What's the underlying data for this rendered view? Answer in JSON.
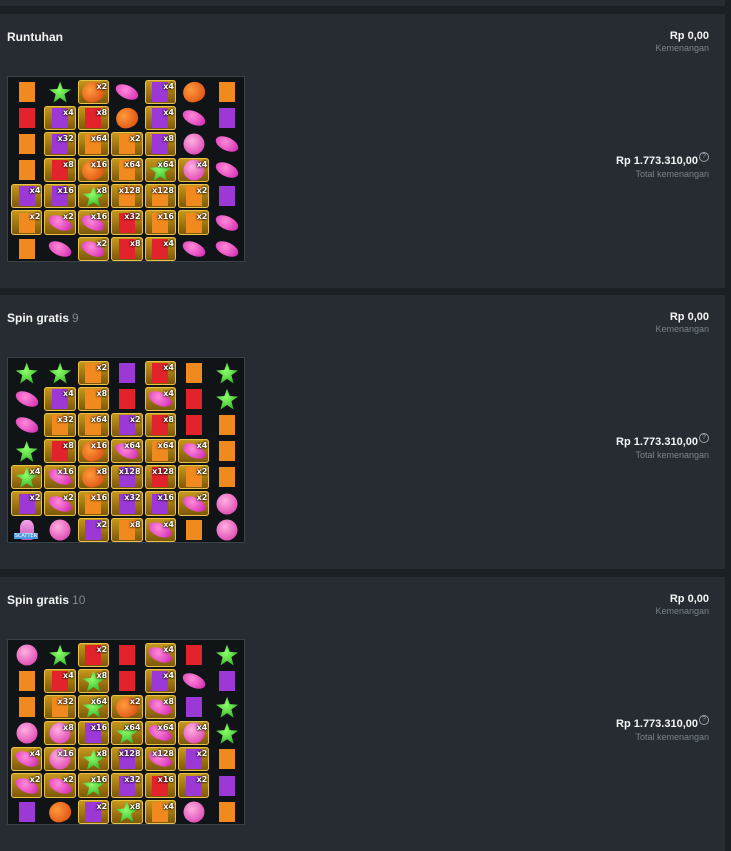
{
  "panels": [
    {
      "title": "Runtuhan",
      "count": "",
      "win_amount": "Rp 0,00",
      "win_label": "Kemenangan",
      "total_amount": "Rp 1.773.310,00",
      "total_label": "Total kemenangan",
      "grid": [
        [
          [
            "bear-orange",
            ""
          ],
          [
            "star",
            ""
          ],
          [
            "heart",
            "x2"
          ],
          [
            "candy",
            ""
          ],
          [
            "bear-purple",
            "x4"
          ],
          [
            "heart",
            ""
          ],
          [
            "bear-orange",
            ""
          ]
        ],
        [
          [
            "bear-red",
            ""
          ],
          [
            "bear-purple",
            "x4"
          ],
          [
            "bear-red",
            "x8"
          ],
          [
            "heart",
            ""
          ],
          [
            "bear-purple",
            "x4"
          ],
          [
            "candy",
            ""
          ],
          [
            "bear-purple",
            ""
          ]
        ],
        [
          [
            "bear-orange",
            ""
          ],
          [
            "bear-purple",
            "x32"
          ],
          [
            "bear-orange",
            "x64"
          ],
          [
            "bear-orange",
            "x2"
          ],
          [
            "bear-purple",
            "x8"
          ],
          [
            "ball",
            ""
          ],
          [
            "candy",
            ""
          ]
        ],
        [
          [
            "bear-orange",
            ""
          ],
          [
            "bear-red",
            "x8"
          ],
          [
            "heart",
            "x16"
          ],
          [
            "bear-orange",
            "x64"
          ],
          [
            "star",
            "x64"
          ],
          [
            "ball",
            "x4"
          ],
          [
            "candy",
            ""
          ]
        ],
        [
          [
            "bear-purple",
            "x4"
          ],
          [
            "bear-purple",
            "x16"
          ],
          [
            "star",
            "x8"
          ],
          [
            "bear-orange",
            "x128"
          ],
          [
            "bear-orange",
            "x128"
          ],
          [
            "bear-orange",
            "x2"
          ],
          [
            "bear-purple",
            ""
          ]
        ],
        [
          [
            "bear-orange",
            "x2"
          ],
          [
            "candy",
            "x2"
          ],
          [
            "candy",
            "x16"
          ],
          [
            "bear-red",
            "x32"
          ],
          [
            "bear-orange",
            "x16"
          ],
          [
            "bear-orange",
            "x2"
          ],
          [
            "candy",
            ""
          ]
        ],
        [
          [
            "bear-orange",
            ""
          ],
          [
            "candy",
            ""
          ],
          [
            "candy",
            "x2"
          ],
          [
            "bear-red",
            "x8"
          ],
          [
            "bear-red",
            "x4"
          ],
          [
            "candy",
            ""
          ],
          [
            "candy",
            ""
          ]
        ]
      ]
    },
    {
      "title": "Spin gratis",
      "count": "9",
      "win_amount": "Rp 0,00",
      "win_label": "Kemenangan",
      "total_amount": "Rp 1.773.310,00",
      "total_label": "Total kemenangan",
      "grid": [
        [
          [
            "star",
            ""
          ],
          [
            "star",
            ""
          ],
          [
            "bear-orange",
            "x2"
          ],
          [
            "bear-purple",
            ""
          ],
          [
            "bear-red",
            "x4"
          ],
          [
            "bear-orange",
            ""
          ],
          [
            "star",
            ""
          ]
        ],
        [
          [
            "candy",
            ""
          ],
          [
            "bear-purple",
            "x4"
          ],
          [
            "bear-orange",
            "x8"
          ],
          [
            "bear-red",
            ""
          ],
          [
            "candy",
            "x4"
          ],
          [
            "bear-red",
            ""
          ],
          [
            "star",
            ""
          ]
        ],
        [
          [
            "candy",
            ""
          ],
          [
            "bear-orange",
            "x32"
          ],
          [
            "bear-orange",
            "x64"
          ],
          [
            "bear-purple",
            "x2"
          ],
          [
            "bear-red",
            "x8"
          ],
          [
            "bear-red",
            ""
          ],
          [
            "bear-orange",
            ""
          ]
        ],
        [
          [
            "star",
            ""
          ],
          [
            "bear-red",
            "x8"
          ],
          [
            "heart",
            "x16"
          ],
          [
            "candy",
            "x64"
          ],
          [
            "bear-orange",
            "x64"
          ],
          [
            "candy",
            "x4"
          ],
          [
            "bear-orange",
            ""
          ]
        ],
        [
          [
            "star",
            "x4"
          ],
          [
            "candy",
            "x16"
          ],
          [
            "heart",
            "x8"
          ],
          [
            "bear-purple",
            "x128"
          ],
          [
            "bear-red",
            "x128"
          ],
          [
            "bear-orange",
            "x2"
          ],
          [
            "bear-orange",
            ""
          ]
        ],
        [
          [
            "bear-purple",
            "x2"
          ],
          [
            "candy",
            "x2"
          ],
          [
            "bear-orange",
            "x16"
          ],
          [
            "bear-purple",
            "x32"
          ],
          [
            "bear-purple",
            "x16"
          ],
          [
            "candy",
            "x2"
          ],
          [
            "ball",
            ""
          ]
        ],
        [
          [
            "scatter",
            ""
          ],
          [
            "ball",
            ""
          ],
          [
            "bear-purple",
            "x2"
          ],
          [
            "bear-orange",
            "x8"
          ],
          [
            "candy",
            "x4"
          ],
          [
            "bear-orange",
            ""
          ],
          [
            "ball",
            ""
          ]
        ]
      ]
    },
    {
      "title": "Spin gratis",
      "count": "10",
      "win_amount": "Rp 0,00",
      "win_label": "Kemenangan",
      "total_amount": "Rp 1.773.310,00",
      "total_label": "Total kemenangan",
      "grid": [
        [
          [
            "ball",
            ""
          ],
          [
            "star",
            ""
          ],
          [
            "bear-red",
            "x2"
          ],
          [
            "bear-red",
            ""
          ],
          [
            "candy",
            "x4"
          ],
          [
            "bear-red",
            ""
          ],
          [
            "star",
            ""
          ]
        ],
        [
          [
            "bear-orange",
            ""
          ],
          [
            "bear-red",
            "x4"
          ],
          [
            "star",
            "x8"
          ],
          [
            "bear-red",
            ""
          ],
          [
            "bear-purple",
            "x4"
          ],
          [
            "candy",
            ""
          ],
          [
            "bear-purple",
            ""
          ]
        ],
        [
          [
            "bear-orange",
            ""
          ],
          [
            "bear-orange",
            "x32"
          ],
          [
            "star",
            "x64"
          ],
          [
            "heart",
            "x2"
          ],
          [
            "candy",
            "x8"
          ],
          [
            "bear-purple",
            ""
          ],
          [
            "star",
            ""
          ]
        ],
        [
          [
            "ball",
            ""
          ],
          [
            "ball",
            "x8"
          ],
          [
            "bear-purple",
            "x16"
          ],
          [
            "star",
            "x64"
          ],
          [
            "candy",
            "x64"
          ],
          [
            "ball",
            "x4"
          ],
          [
            "star",
            ""
          ]
        ],
        [
          [
            "candy",
            "x4"
          ],
          [
            "ball",
            "x16"
          ],
          [
            "star",
            "x8"
          ],
          [
            "bear-purple",
            "x128"
          ],
          [
            "candy",
            "x128"
          ],
          [
            "bear-purple",
            "x2"
          ],
          [
            "bear-orange",
            ""
          ]
        ],
        [
          [
            "candy",
            "x2"
          ],
          [
            "candy",
            "x2"
          ],
          [
            "star",
            "x16"
          ],
          [
            "bear-purple",
            "x32"
          ],
          [
            "bear-red",
            "x16"
          ],
          [
            "bear-purple",
            "x2"
          ],
          [
            "bear-purple",
            ""
          ]
        ],
        [
          [
            "bear-purple",
            ""
          ],
          [
            "heart",
            ""
          ],
          [
            "bear-purple",
            "x2"
          ],
          [
            "star",
            "x8"
          ],
          [
            "bear-orange",
            "x4"
          ],
          [
            "ball",
            ""
          ],
          [
            "bear-orange",
            ""
          ]
        ]
      ]
    }
  ]
}
